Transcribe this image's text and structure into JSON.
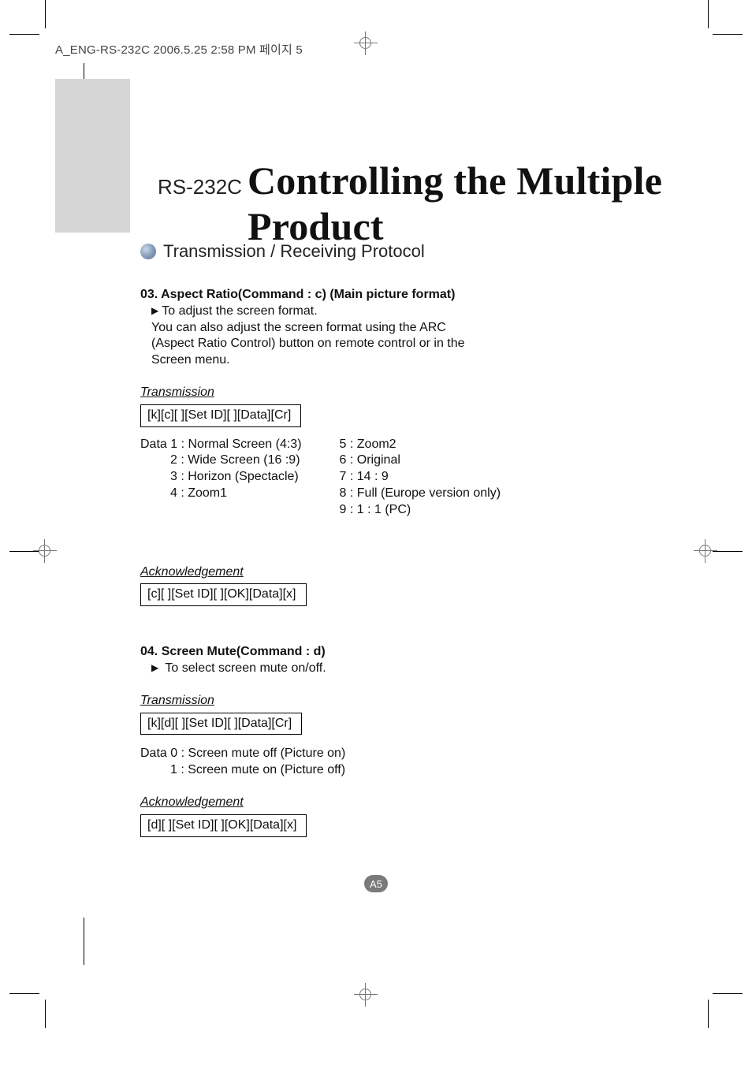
{
  "print_header": "A_ENG-RS-232C  2006.5.25  2:58 PM  페이지 5",
  "prefix_title": "RS-232C",
  "main_title": "Controlling the Multiple Product",
  "section_title": "Transmission / Receiving Protocol",
  "cmd03": {
    "heading": "03. Aspect Ratio(Command : c) (Main picture format)",
    "desc_lead": "To adjust the screen format.",
    "desc_rest": "You can also adjust the screen format using the ARC (Aspect Ratio Control) button on remote control or in the Screen menu.",
    "tx_label": "Transmission",
    "tx_code": "[k][c][ ][Set ID][ ][Data][Cr]",
    "data_word": "Data",
    "colA": {
      "1": "1 : Normal Screen (4:3)",
      "2": "2 : Wide Screen (16 :9)",
      "3": "3 : Horizon (Spectacle)",
      "4": "4 : Zoom1"
    },
    "colB": {
      "5": "5 : Zoom2",
      "6": "6 : Original",
      "7": "7 : 14 : 9",
      "8": "8 : Full (Europe version only)",
      "9": "9 : 1 : 1 (PC)"
    },
    "ack_label": "Acknowledgement",
    "ack_code": "[c][ ][Set ID][ ][OK][Data][x]"
  },
  "cmd04": {
    "heading": "04. Screen Mute(Command : d)",
    "desc_lead": "To select screen mute on/off.",
    "tx_label": "Transmission",
    "tx_code": "[k][d][ ][Set ID][ ][Data][Cr]",
    "data_word": "Data",
    "d0": "0 : Screen mute off (Picture on)",
    "d1": "1 : Screen mute on (Picture off)",
    "ack_label": "Acknowledgement",
    "ack_code": "[d][ ][Set ID][ ][OK][Data][x]"
  },
  "page_number": "A5"
}
